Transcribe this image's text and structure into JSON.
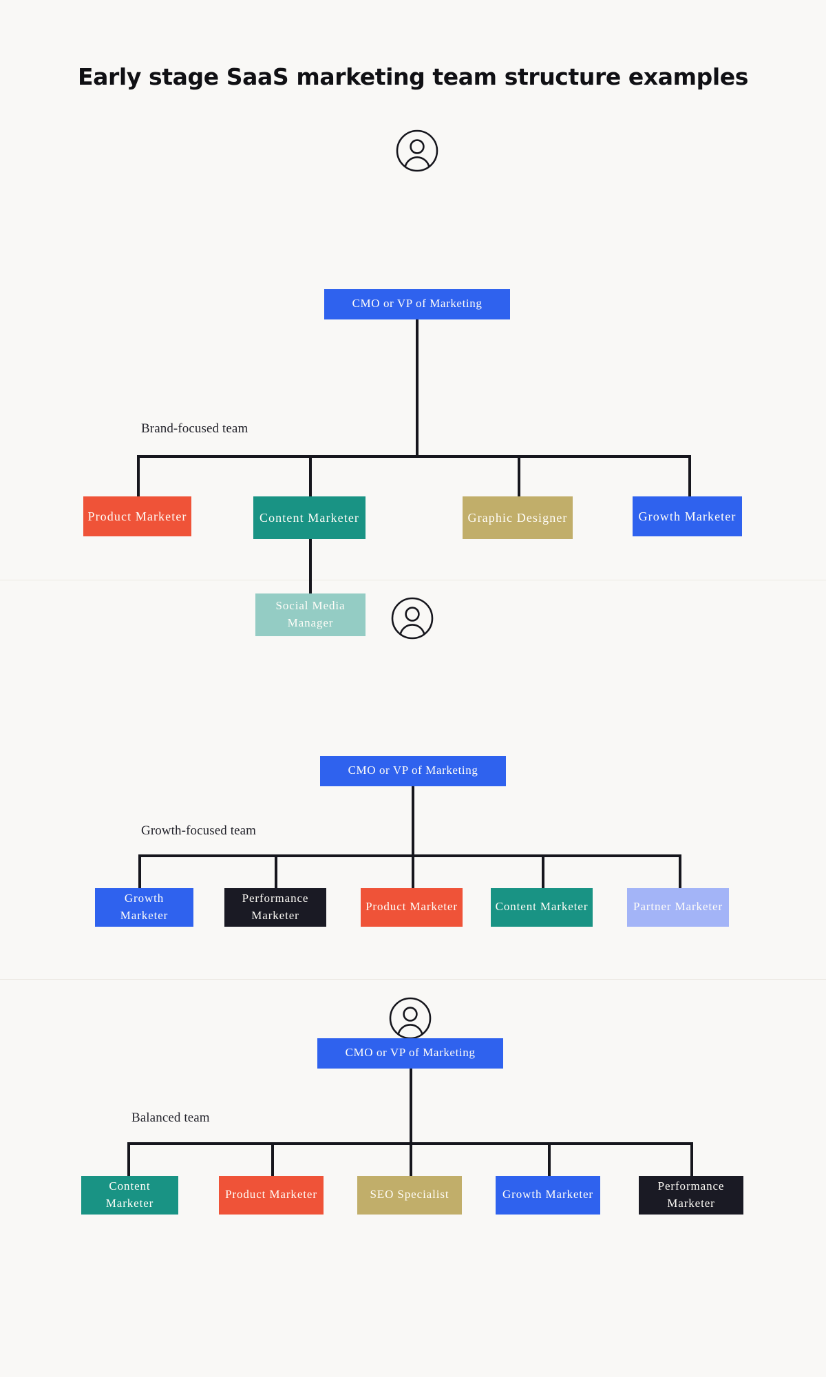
{
  "page": {
    "title": "Early stage SaaS marketing team structure examples",
    "background_color": "#F9F8F6",
    "connector_color": "#16161D"
  },
  "palette": {
    "blue": "#2F62EE",
    "orange_red": "#EF5338",
    "teal": "#199384",
    "khaki": "#C1AE6A",
    "light_teal": "#94CCC4",
    "dark": "#1A1A24",
    "periwinkle": "#A3B4F7",
    "text_on_fill": "#FFFDF8"
  },
  "icons": {
    "avatar": "user-avatar-icon"
  },
  "charts": [
    {
      "id": "brand-focused",
      "group_label": "Brand-focused team",
      "root": {
        "label": "CMO or VP of Marketing",
        "color": "#2F62EE"
      },
      "children": [
        {
          "label": "Product Marketer",
          "color": "#EF5338"
        },
        {
          "label": "Content Marketer",
          "color": "#199384"
        },
        {
          "label": "Graphic Designer",
          "color": "#C1AE6A"
        },
        {
          "label": "Growth Marketer",
          "color": "#2F62EE"
        }
      ],
      "grandchildren": [
        {
          "label": "Social Media Manager",
          "color": "#94CCC4",
          "parent": "Content Marketer"
        }
      ]
    },
    {
      "id": "growth-focused",
      "group_label": "Growth-focused team",
      "root": {
        "label": "CMO or VP of Marketing",
        "color": "#2F62EE"
      },
      "children": [
        {
          "label": "Growth Marketer",
          "color": "#2F62EE"
        },
        {
          "label": "Performance Marketer",
          "color": "#1A1A24"
        },
        {
          "label": "Product Marketer",
          "color": "#EF5338"
        },
        {
          "label": "Content Marketer",
          "color": "#199384"
        },
        {
          "label": "Partner Marketer",
          "color": "#A3B4F7"
        }
      ],
      "grandchildren": []
    },
    {
      "id": "balanced",
      "group_label": "Balanced team",
      "root": {
        "label": "CMO or VP of Marketing",
        "color": "#2F62EE"
      },
      "children": [
        {
          "label": "Content Marketer",
          "color": "#199384"
        },
        {
          "label": "Product Marketer",
          "color": "#EF5338"
        },
        {
          "label": "SEO Specialist",
          "color": "#C1AE6A"
        },
        {
          "label": "Growth Marketer",
          "color": "#2F62EE"
        },
        {
          "label": "Performance Marketer",
          "color": "#1A1A24"
        }
      ],
      "grandchildren": []
    }
  ]
}
